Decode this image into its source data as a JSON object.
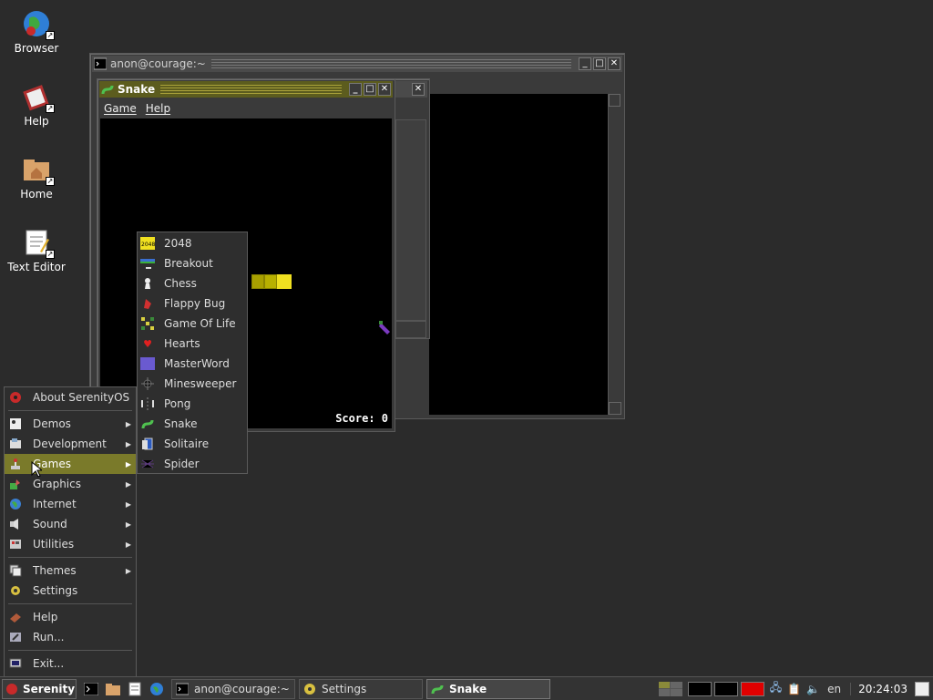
{
  "desktop": {
    "icons": [
      {
        "label": "Browser"
      },
      {
        "label": "Help"
      },
      {
        "label": "Home"
      },
      {
        "label": "Text Editor"
      }
    ]
  },
  "terminal": {
    "title": "anon@courage:~"
  },
  "snake": {
    "title": "Snake",
    "menu": [
      "Game",
      "Help"
    ],
    "score": "Score: 0"
  },
  "start_menu": {
    "items": [
      {
        "label": "About SerenityOS"
      },
      {
        "label": "Demos"
      },
      {
        "label": "Development"
      },
      {
        "label": "Games"
      },
      {
        "label": "Graphics"
      },
      {
        "label": "Internet"
      },
      {
        "label": "Sound"
      },
      {
        "label": "Utilities"
      },
      {
        "label": "Themes"
      },
      {
        "label": "Settings"
      },
      {
        "label": "Help"
      },
      {
        "label": "Run..."
      },
      {
        "label": "Exit..."
      }
    ]
  },
  "games_menu": {
    "items": [
      {
        "label": "2048"
      },
      {
        "label": "Breakout"
      },
      {
        "label": "Chess"
      },
      {
        "label": "Flappy Bug"
      },
      {
        "label": "Game Of Life"
      },
      {
        "label": "Hearts"
      },
      {
        "label": "MasterWord"
      },
      {
        "label": "Minesweeper"
      },
      {
        "label": "Pong"
      },
      {
        "label": "Snake"
      },
      {
        "label": "Solitaire"
      },
      {
        "label": "Spider"
      }
    ]
  },
  "taskbar": {
    "start_label": "Serenity",
    "tasks": [
      {
        "label": "anon@courage:~"
      },
      {
        "label": "Settings"
      },
      {
        "label": "Snake"
      }
    ],
    "keymap": "en",
    "clock": "20:24:03"
  }
}
